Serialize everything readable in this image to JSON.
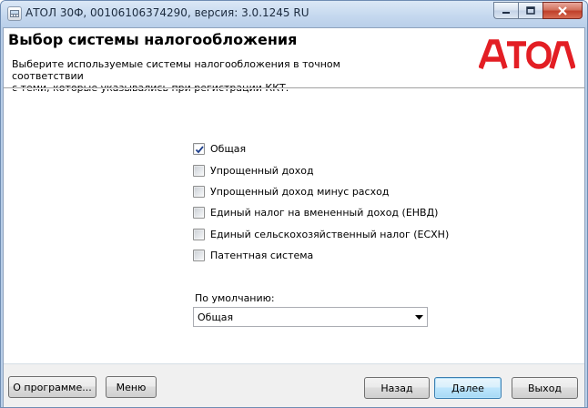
{
  "window": {
    "title": "АТОЛ 30Ф, 00106106374290, версия: 3.0.1245 RU",
    "icons": {
      "minimize": "minimize-icon",
      "maximize": "maximize-icon",
      "close": "close-icon"
    }
  },
  "header": {
    "title": "Выбор системы налогообложения",
    "description_line1": "Выберите используемые системы налогообложения в точном соответствии",
    "description_line2": "с теми, которые указывались при регистрации ККТ.",
    "logo_text": "АТОЛ",
    "logo_color": "#e31e24"
  },
  "tax_systems": [
    {
      "label": "Общая",
      "checked": true
    },
    {
      "label": "Упрощенный доход",
      "checked": false
    },
    {
      "label": "Упрощенный доход минус расход",
      "checked": false
    },
    {
      "label": "Единый налог на вмененный доход (ЕНВД)",
      "checked": false
    },
    {
      "label": "Единый сельскохозяйственный налог (ЕСХН)",
      "checked": false
    },
    {
      "label": "Патентная система",
      "checked": false
    }
  ],
  "default_select": {
    "label": "По умолчанию:",
    "value": "Общая"
  },
  "footer": {
    "about_label": "О программе...",
    "menu_label": "Меню",
    "back_label": "Назад",
    "next_label": "Далее",
    "exit_label": "Выход"
  }
}
